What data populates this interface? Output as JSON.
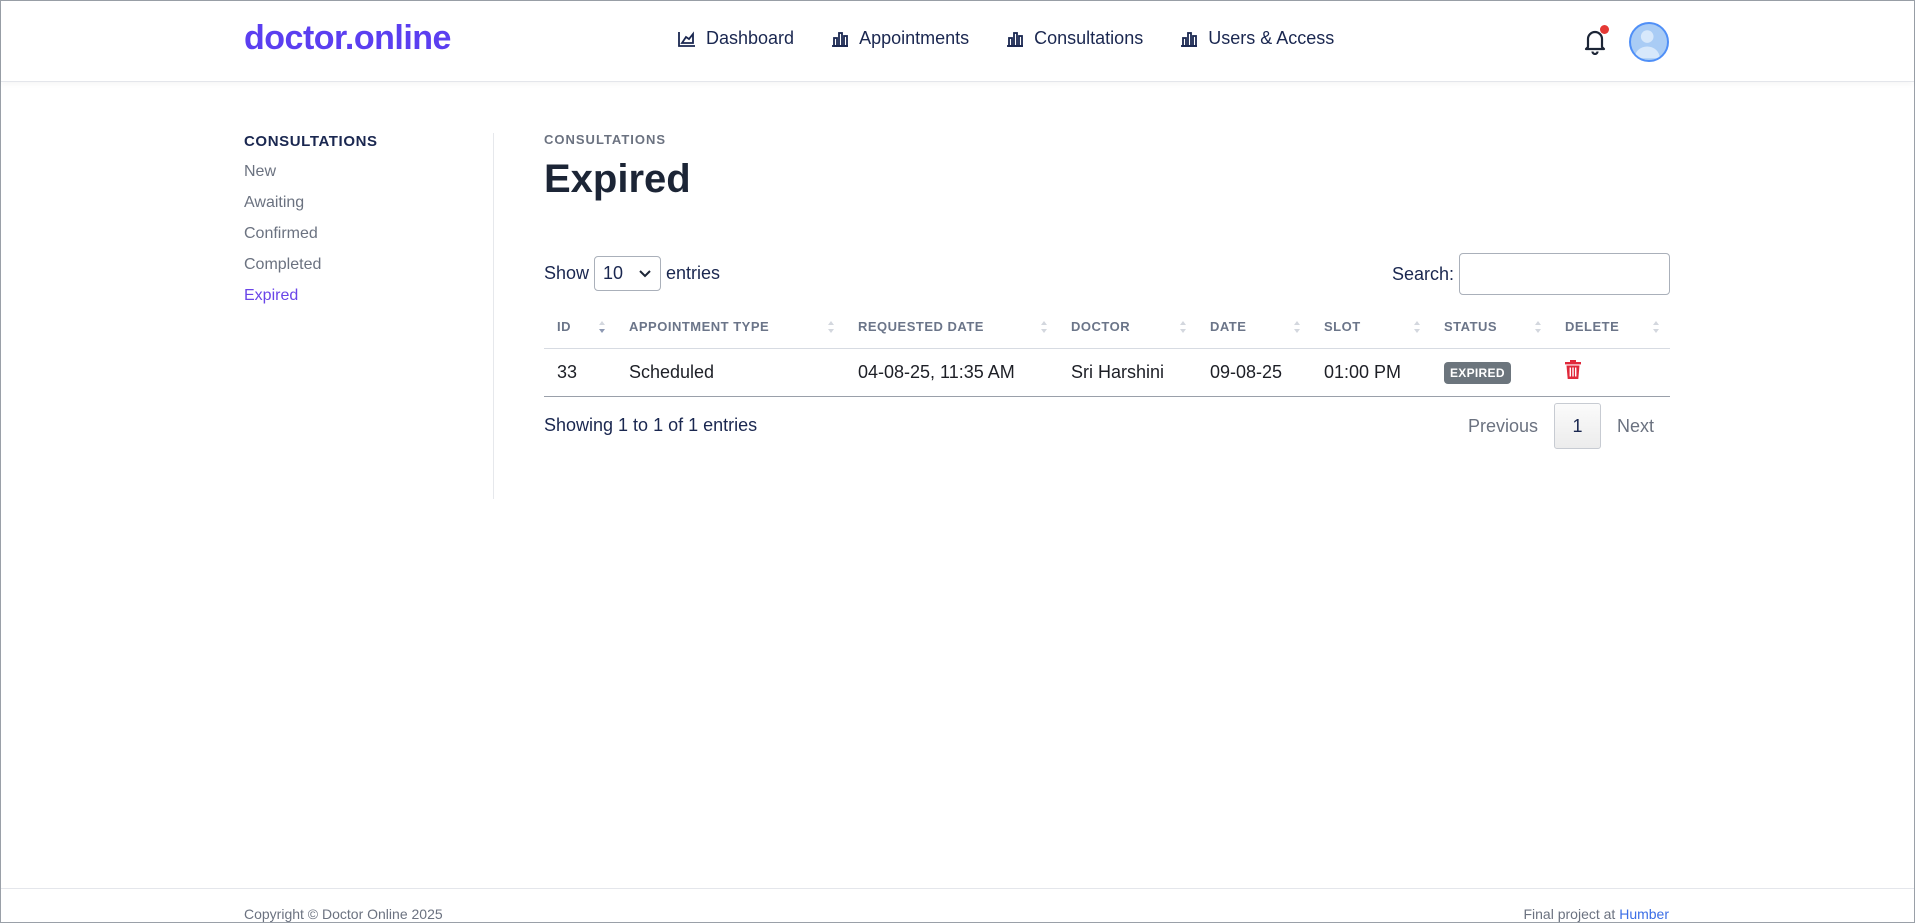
{
  "brand": "doctor.online",
  "nav": {
    "items": [
      {
        "label": "Dashboard",
        "icon": "chart-area-icon"
      },
      {
        "label": "Appointments",
        "icon": "chart-bar-icon"
      },
      {
        "label": "Consultations",
        "icon": "chart-bar-icon"
      },
      {
        "label": "Users & Access",
        "icon": "chart-bar-icon"
      }
    ]
  },
  "sidebar": {
    "heading": "CONSULTATIONS",
    "items": [
      {
        "label": "New"
      },
      {
        "label": "Awaiting"
      },
      {
        "label": "Confirmed"
      },
      {
        "label": "Completed"
      },
      {
        "label": "Expired",
        "active": true
      }
    ]
  },
  "main": {
    "eyebrow": "CONSULTATIONS",
    "title": "Expired",
    "show_label": "Show",
    "entries_value": "10",
    "entries_label": "entries",
    "search_label": "Search:",
    "search_value": ""
  },
  "table": {
    "columns": [
      "ID",
      "APPOINTMENT TYPE",
      "REQUESTED DATE",
      "DOCTOR",
      "DATE",
      "SLOT",
      "STATUS",
      "DELETE"
    ],
    "rows": [
      {
        "id": "33",
        "type": "Scheduled",
        "requested": "04-08-25, 11:35 AM",
        "doctor": "Sri Harshini",
        "date": "09-08-25",
        "slot": "01:00 PM",
        "status": "EXPIRED"
      }
    ]
  },
  "pagination": {
    "info": "Showing 1 to 1 of 1 entries",
    "previous": "Previous",
    "page": "1",
    "next": "Next"
  },
  "footer": {
    "copyright": "Copyright © Doctor Online 2025",
    "credit_prefix": "Final project at",
    "credit_link": "Humber"
  },
  "colors": {
    "brand": "#5b3ff0",
    "active_link": "#6a45e8",
    "badge": "#6c757d",
    "delete": "#e0283a",
    "notification_dot": "#e53935"
  }
}
